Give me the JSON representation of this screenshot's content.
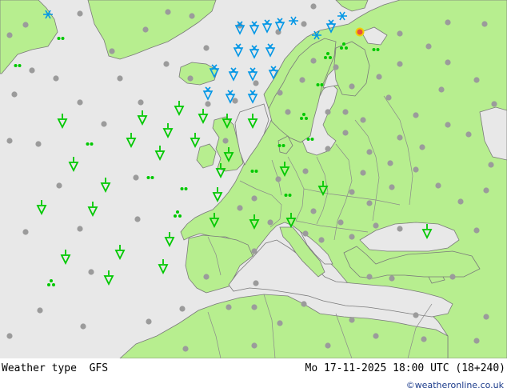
{
  "map": {
    "field": "Weather type",
    "model": "GFS",
    "valid_time": "Mo 17-11-2025 18:00 UTC (18+240)",
    "credit": "©weatheronline.co.uk",
    "colors": {
      "sea": "#e8e8e8",
      "land": "#b7ee8f",
      "border": "#7a7a7a",
      "rain_symbol": "#00c800",
      "snow_symbol": "#0096e6",
      "station_dot": "#9b9b9b",
      "alert": "#e8503c",
      "alert_ring": "#f0d000"
    },
    "symbol_types": [
      "rain-shower-icon",
      "drizzle-icon",
      "snow-icon",
      "snow-shower-icon",
      "cloud-dot"
    ]
  }
}
